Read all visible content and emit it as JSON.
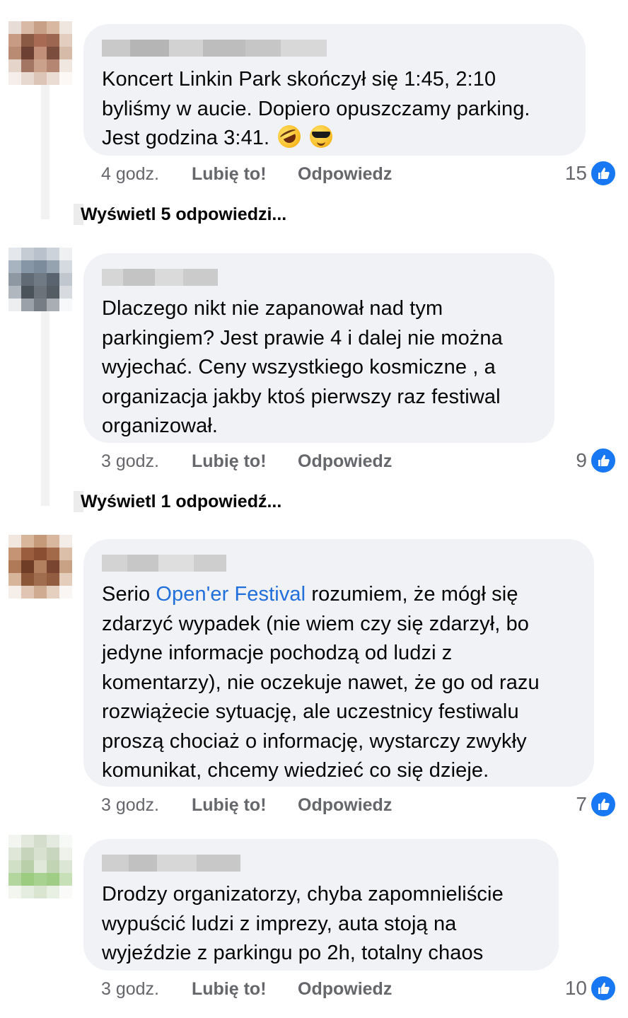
{
  "comments": [
    {
      "text": "Koncert Linkin Park skończył się 1:45, 2:10 byliśmy w aucie. Dopiero opuszczamy parking. Jest godzina 3:41.",
      "emojis": [
        "rolling-on-floor-laughing-emoji",
        "smiling-face-with-sunglasses-emoji"
      ],
      "time": "4 godz.",
      "like_label": "Lubię to!",
      "reply_label": "Odpowiedz",
      "reaction_count": "15",
      "replies_link": "Wyświetl 5 odpowiedzi..."
    },
    {
      "text": "Dlaczego nikt nie zapanował nad tym parkingiem? Jest prawie 4 i dalej nie można wyjechać. Ceny wszystkiego kosmiczne , a organizacja jakby ktoś pierwszy raz festiwal organizował.",
      "time": "3 godz.",
      "like_label": "Lubię to!",
      "reply_label": "Odpowiedz",
      "reaction_count": "9",
      "replies_link": "Wyświetl 1 odpowiedź..."
    },
    {
      "text_before": "Serio ",
      "mention": "Open'er Festival",
      "text_after": " rozumiem, że mógł się zdarzyć wypadek (nie wiem czy się zdarzył, bo jedyne informacje pochodzą od ludzi z komentarzy), nie oczekuje nawet, że go od razu rozwiążecie sytuację, ale uczestnicy festiwalu proszą chociaż o informację, wystarczy zwykły komunikat, chcemy wiedzieć co się dzieje.",
      "time": "3 godz.",
      "like_label": "Lubię to!",
      "reply_label": "Odpowiedz",
      "reaction_count": "7"
    },
    {
      "text": "Drodzy organizatorzy, chyba zapomnieliście wypuścić ludzi z imprezy, auta stoją na wyjeździe z parkingu po 2h, totalny chaos",
      "time": "3 godz.",
      "like_label": "Lubię to!",
      "reply_label": "Odpowiedz",
      "reaction_count": "10"
    }
  ],
  "colors": {
    "bubble": "#f0f2f5",
    "meta_text": "#65676b",
    "mention": "#216fdb",
    "like_blue": "#1877f2"
  },
  "icons": {
    "reaction": "like-thumbs-up-icon"
  }
}
